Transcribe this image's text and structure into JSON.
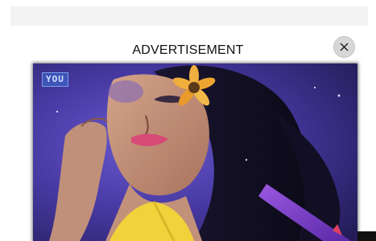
{
  "ad": {
    "label": "ADVERTISEMENT",
    "logo_text": "YOU",
    "close_icon": "close-icon",
    "video_label": "advertisement-video"
  },
  "colors": {
    "top_bar": "#f3f3f3",
    "close_bg": "#d7d7d7",
    "ad_bg": "#2a2560",
    "accent_purple": "#5b3fb0",
    "accent_yellow": "#f2d23a"
  }
}
